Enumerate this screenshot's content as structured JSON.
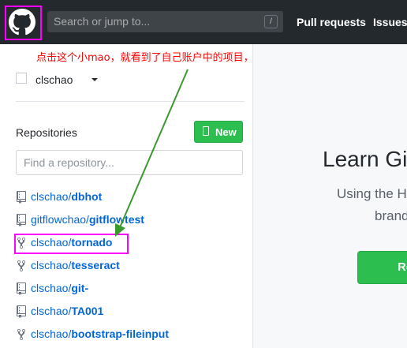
{
  "header": {
    "search_placeholder": "Search or jump to...",
    "slash_key": "/",
    "nav": [
      "Pull requests",
      "Issues"
    ]
  },
  "annotation": "点击这个小mao，就看到了自己账户中的项目，就有了这个tornado了",
  "user": {
    "name": "clschao"
  },
  "repositories": {
    "title": "Repositories",
    "new_label": "New",
    "find_placeholder": "Find a repository...",
    "items": [
      {
        "owner": "clschao/",
        "name": "dbhot",
        "icon": "repo-icon"
      },
      {
        "owner": "gitflowchao/",
        "name": "gitflowtest",
        "icon": "repo-icon"
      },
      {
        "owner": "clschao/",
        "name": "tornado",
        "icon": "fork-icon"
      },
      {
        "owner": "clschao/",
        "name": "tesseract",
        "icon": "fork-icon"
      },
      {
        "owner": "clschao/",
        "name": "git-",
        "icon": "repo-icon"
      },
      {
        "owner": "clschao/",
        "name": "TA001",
        "icon": "repo-icon"
      },
      {
        "owner": "clschao/",
        "name": "bootstrap-fileinput",
        "icon": "fork-icon"
      }
    ]
  },
  "right": {
    "heading": "Learn Gi",
    "line1": "Using the H",
    "line2": "brand",
    "button_label": "Re"
  },
  "colors": {
    "header_bg": "#24292e",
    "link": "#0366d6",
    "button_green": "#2cbe4e",
    "annotation": "#ff0000",
    "highlight": "#ff00ff"
  }
}
